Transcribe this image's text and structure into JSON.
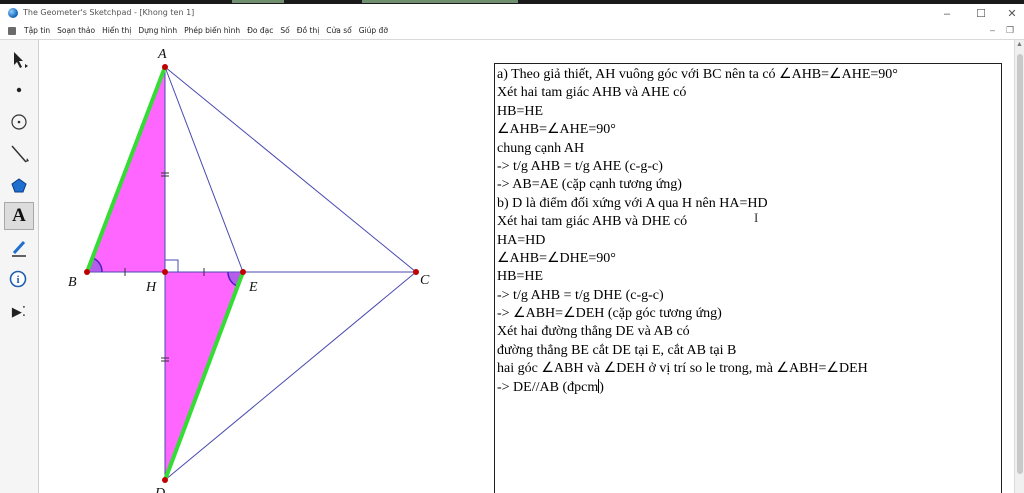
{
  "window": {
    "title": "The Geometer's Sketchpad - [Khong ten 1]",
    "minimize_glyph": "–",
    "maximize_glyph": "☐",
    "close_glyph": "✕"
  },
  "menu": {
    "items": [
      "Tập tin",
      "Soạn thảo",
      "Hiển thị",
      "Dựng hình",
      "Phép biến hình",
      "Đo đạc",
      "Số",
      "Đồ thị",
      "Cửa sổ",
      "Giúp đỡ"
    ],
    "doc_minimize": "–",
    "doc_restore": "❐"
  },
  "toolbar": {
    "tools": [
      "arrow-select-icon",
      "point-icon",
      "compass-icon",
      "straightedge-icon",
      "polygon-icon",
      "text-icon",
      "marker-icon",
      "information-icon",
      "custom-tool-icon"
    ],
    "text_tool_glyph": "A",
    "info_glyph": "i",
    "custom_glyph": "▶⁚"
  },
  "sketch": {
    "labels": {
      "A": "A",
      "B": "B",
      "H": "H",
      "E": "E",
      "C": "C",
      "D": "D"
    },
    "colors": {
      "fill": "#ff66ff",
      "green": "#33dd33",
      "lines": "#4a4ab0",
      "points": "#c00000",
      "arc": "#4422bb"
    }
  },
  "textbox": {
    "lines": [
      "a) Theo giả thiết, AH vuông góc với BC nên ta có ∠AHB=∠AHE=90°",
      "Xét hai tam giác AHB và AHE có",
      "HB=HE",
      "∠AHB=∠AHE=90°",
      "chung cạnh AH",
      "-> t/g AHB = t/g AHE (c-g-c)",
      "-> AB=AE (cặp cạnh tương ứng)",
      "b) D là điểm đối xứng với A qua H nên HA=HD",
      "Xét hai tam giác AHB và DHE có",
      "HA=HD",
      "∠AHB=∠DHE=90°",
      "HB=HE",
      "-> t/g AHB = t/g DHE (c-g-c)",
      "-> ∠ABH=∠DEH (cặp góc tương ứng)",
      "Xét hai đường thẳng DE và AB có",
      "đường thẳng BE cắt DE tại E, cắt AB tại B",
      "hai góc ∠ABH và ∠DEH ở vị trí so le trong, mà ∠ABH=∠DEH",
      "-> DE//AB (đpcm"
    ],
    "last_line_tail": ")",
    "ibeam_glyph": "I"
  }
}
